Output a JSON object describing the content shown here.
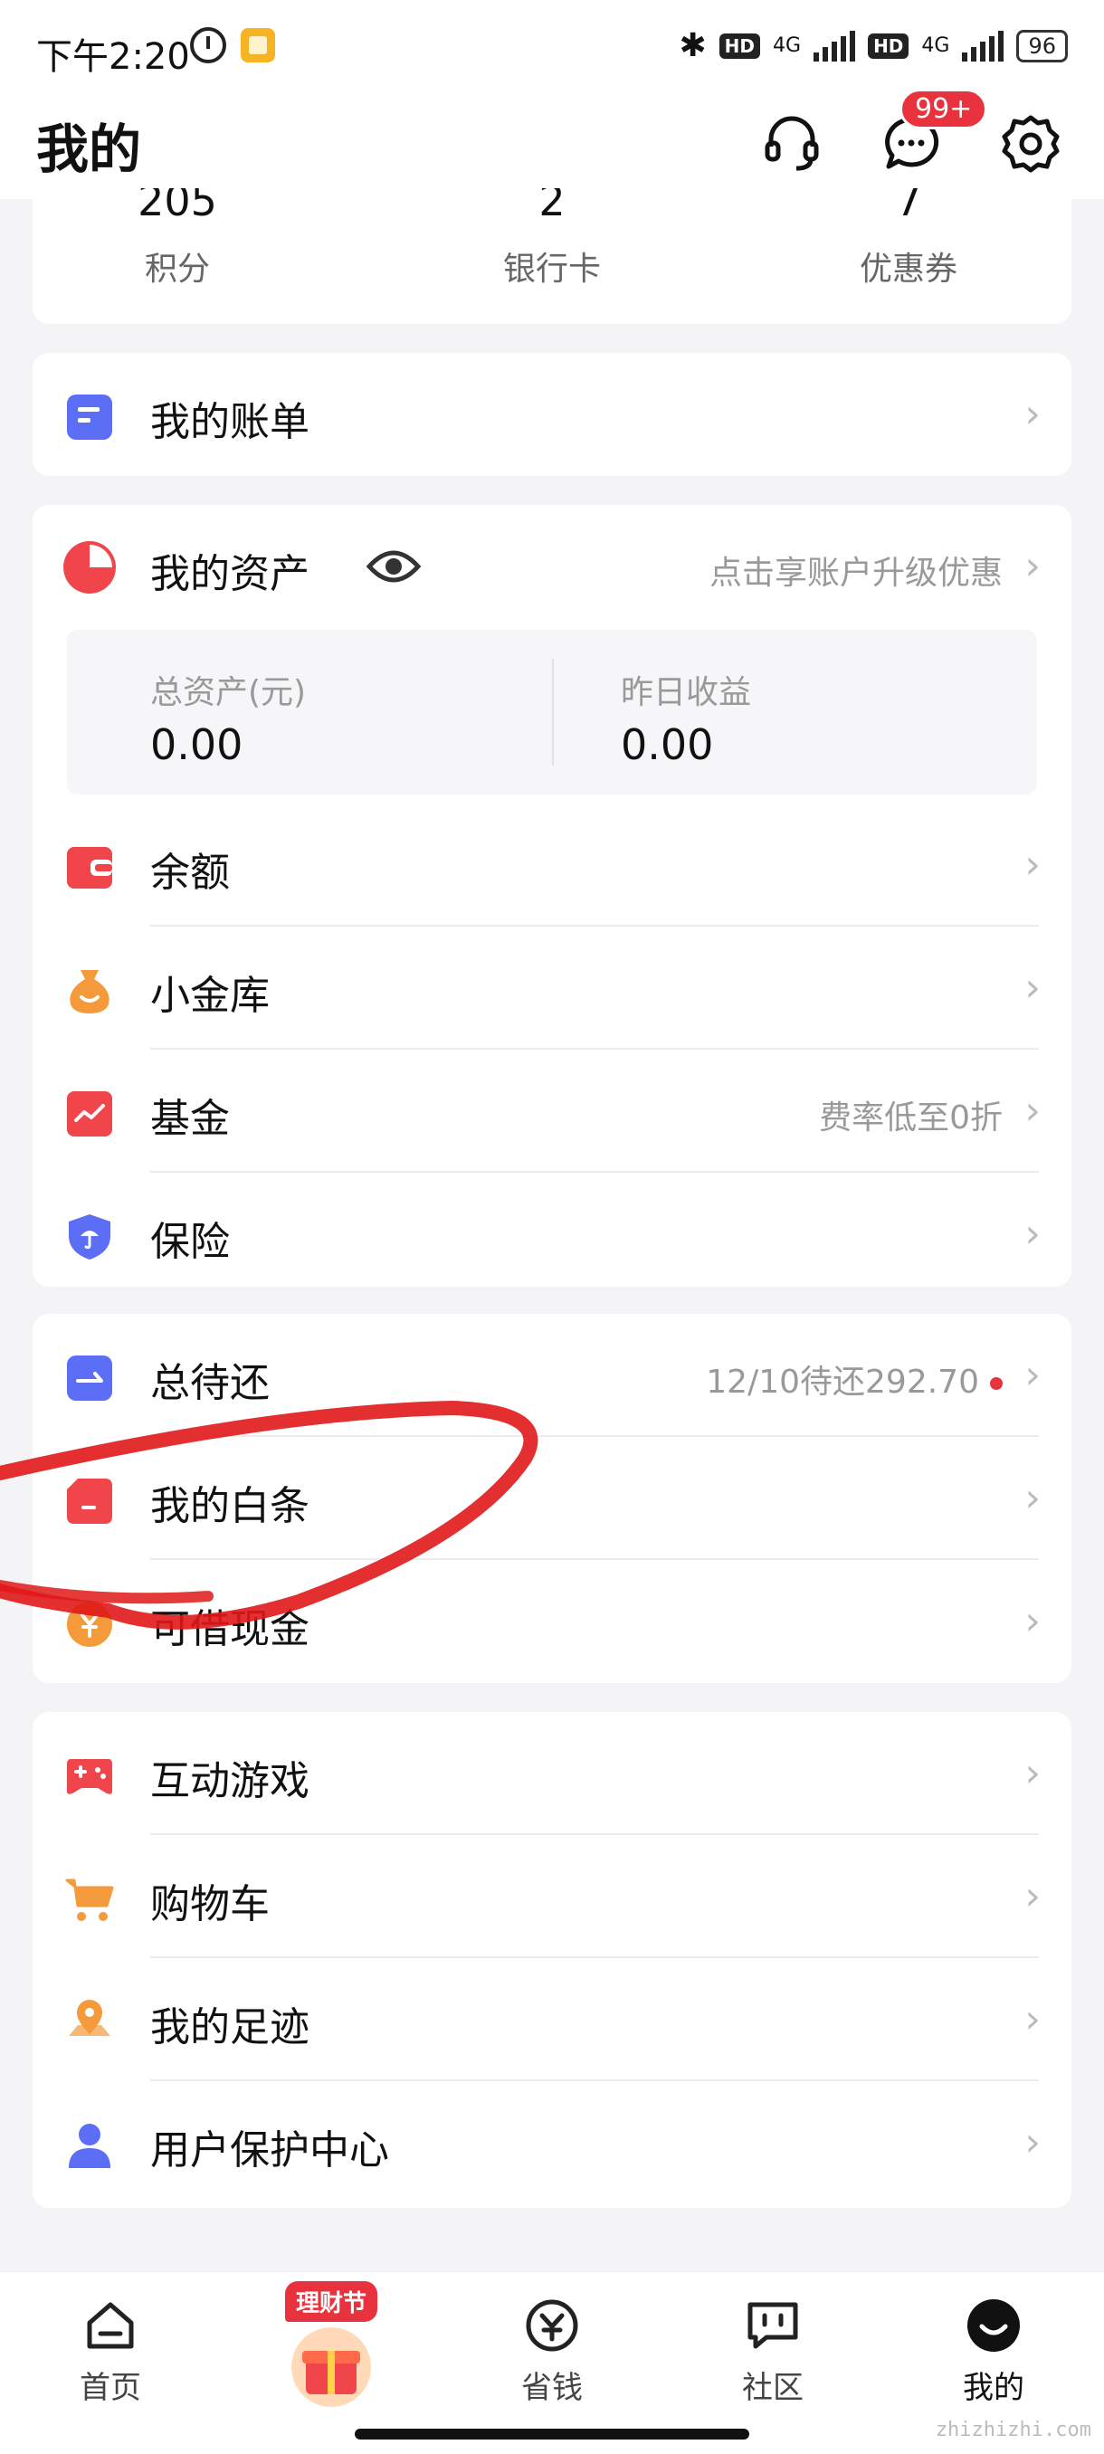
{
  "status_bar": {
    "time": "下午2:20",
    "network": "4G",
    "hd": "HD",
    "battery": "96"
  },
  "header": {
    "title": "我的",
    "message_badge": "99+"
  },
  "stats": [
    {
      "value": "205",
      "label": "积分"
    },
    {
      "value": "2",
      "label": "银行卡"
    },
    {
      "value": "7",
      "label": "优惠券"
    }
  ],
  "bill": {
    "label": "我的账单"
  },
  "assets": {
    "label": "我的资产",
    "hint": "点击享账户升级优惠",
    "total_label": "总资产(元)",
    "total_value": "0.00",
    "yesterday_label": "昨日收益",
    "yesterday_value": "0.00",
    "items": [
      {
        "label": "余额",
        "hint": ""
      },
      {
        "label": "小金库",
        "hint": ""
      },
      {
        "label": "基金",
        "hint": "费率低至0折"
      },
      {
        "label": "保险",
        "hint": ""
      }
    ]
  },
  "credit": {
    "items": [
      {
        "label": "总待还",
        "hint": "12/10待还292.70"
      },
      {
        "label": "我的白条",
        "hint": ""
      },
      {
        "label": "可借现金",
        "hint": ""
      }
    ]
  },
  "more": {
    "items": [
      {
        "label": "互动游戏"
      },
      {
        "label": "购物车"
      },
      {
        "label": "我的足迹"
      },
      {
        "label": "用户保护中心"
      }
    ]
  },
  "tabbar": {
    "tabs": [
      {
        "label": "首页"
      },
      {
        "label": "理财节"
      },
      {
        "label": "省钱"
      },
      {
        "label": "社区"
      },
      {
        "label": "我的"
      }
    ]
  },
  "watermark": "zhizhizhi.com",
  "colors": {
    "accent": "#e8323e",
    "blue": "#5b6ef5",
    "orange": "#f59a3a"
  }
}
